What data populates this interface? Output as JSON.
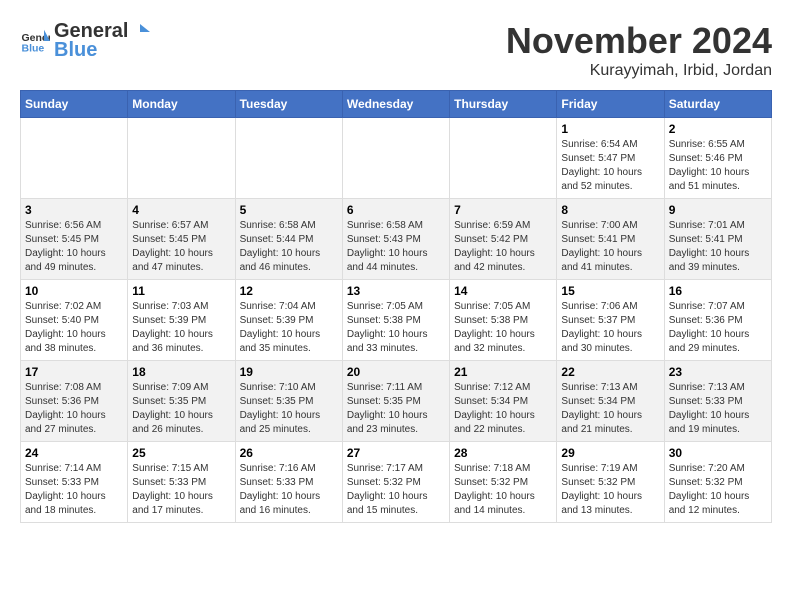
{
  "logo": {
    "text_general": "General",
    "text_blue": "Blue"
  },
  "header": {
    "month": "November 2024",
    "location": "Kurayyimah, Irbid, Jordan"
  },
  "weekdays": [
    "Sunday",
    "Monday",
    "Tuesday",
    "Wednesday",
    "Thursday",
    "Friday",
    "Saturday"
  ],
  "weeks": [
    [
      {
        "day": "",
        "info": ""
      },
      {
        "day": "",
        "info": ""
      },
      {
        "day": "",
        "info": ""
      },
      {
        "day": "",
        "info": ""
      },
      {
        "day": "",
        "info": ""
      },
      {
        "day": "1",
        "info": "Sunrise: 6:54 AM\nSunset: 5:47 PM\nDaylight: 10 hours and 52 minutes."
      },
      {
        "day": "2",
        "info": "Sunrise: 6:55 AM\nSunset: 5:46 PM\nDaylight: 10 hours and 51 minutes."
      }
    ],
    [
      {
        "day": "3",
        "info": "Sunrise: 6:56 AM\nSunset: 5:45 PM\nDaylight: 10 hours and 49 minutes."
      },
      {
        "day": "4",
        "info": "Sunrise: 6:57 AM\nSunset: 5:45 PM\nDaylight: 10 hours and 47 minutes."
      },
      {
        "day": "5",
        "info": "Sunrise: 6:58 AM\nSunset: 5:44 PM\nDaylight: 10 hours and 46 minutes."
      },
      {
        "day": "6",
        "info": "Sunrise: 6:58 AM\nSunset: 5:43 PM\nDaylight: 10 hours and 44 minutes."
      },
      {
        "day": "7",
        "info": "Sunrise: 6:59 AM\nSunset: 5:42 PM\nDaylight: 10 hours and 42 minutes."
      },
      {
        "day": "8",
        "info": "Sunrise: 7:00 AM\nSunset: 5:41 PM\nDaylight: 10 hours and 41 minutes."
      },
      {
        "day": "9",
        "info": "Sunrise: 7:01 AM\nSunset: 5:41 PM\nDaylight: 10 hours and 39 minutes."
      }
    ],
    [
      {
        "day": "10",
        "info": "Sunrise: 7:02 AM\nSunset: 5:40 PM\nDaylight: 10 hours and 38 minutes."
      },
      {
        "day": "11",
        "info": "Sunrise: 7:03 AM\nSunset: 5:39 PM\nDaylight: 10 hours and 36 minutes."
      },
      {
        "day": "12",
        "info": "Sunrise: 7:04 AM\nSunset: 5:39 PM\nDaylight: 10 hours and 35 minutes."
      },
      {
        "day": "13",
        "info": "Sunrise: 7:05 AM\nSunset: 5:38 PM\nDaylight: 10 hours and 33 minutes."
      },
      {
        "day": "14",
        "info": "Sunrise: 7:05 AM\nSunset: 5:38 PM\nDaylight: 10 hours and 32 minutes."
      },
      {
        "day": "15",
        "info": "Sunrise: 7:06 AM\nSunset: 5:37 PM\nDaylight: 10 hours and 30 minutes."
      },
      {
        "day": "16",
        "info": "Sunrise: 7:07 AM\nSunset: 5:36 PM\nDaylight: 10 hours and 29 minutes."
      }
    ],
    [
      {
        "day": "17",
        "info": "Sunrise: 7:08 AM\nSunset: 5:36 PM\nDaylight: 10 hours and 27 minutes."
      },
      {
        "day": "18",
        "info": "Sunrise: 7:09 AM\nSunset: 5:35 PM\nDaylight: 10 hours and 26 minutes."
      },
      {
        "day": "19",
        "info": "Sunrise: 7:10 AM\nSunset: 5:35 PM\nDaylight: 10 hours and 25 minutes."
      },
      {
        "day": "20",
        "info": "Sunrise: 7:11 AM\nSunset: 5:35 PM\nDaylight: 10 hours and 23 minutes."
      },
      {
        "day": "21",
        "info": "Sunrise: 7:12 AM\nSunset: 5:34 PM\nDaylight: 10 hours and 22 minutes."
      },
      {
        "day": "22",
        "info": "Sunrise: 7:13 AM\nSunset: 5:34 PM\nDaylight: 10 hours and 21 minutes."
      },
      {
        "day": "23",
        "info": "Sunrise: 7:13 AM\nSunset: 5:33 PM\nDaylight: 10 hours and 19 minutes."
      }
    ],
    [
      {
        "day": "24",
        "info": "Sunrise: 7:14 AM\nSunset: 5:33 PM\nDaylight: 10 hours and 18 minutes."
      },
      {
        "day": "25",
        "info": "Sunrise: 7:15 AM\nSunset: 5:33 PM\nDaylight: 10 hours and 17 minutes."
      },
      {
        "day": "26",
        "info": "Sunrise: 7:16 AM\nSunset: 5:33 PM\nDaylight: 10 hours and 16 minutes."
      },
      {
        "day": "27",
        "info": "Sunrise: 7:17 AM\nSunset: 5:32 PM\nDaylight: 10 hours and 15 minutes."
      },
      {
        "day": "28",
        "info": "Sunrise: 7:18 AM\nSunset: 5:32 PM\nDaylight: 10 hours and 14 minutes."
      },
      {
        "day": "29",
        "info": "Sunrise: 7:19 AM\nSunset: 5:32 PM\nDaylight: 10 hours and 13 minutes."
      },
      {
        "day": "30",
        "info": "Sunrise: 7:20 AM\nSunset: 5:32 PM\nDaylight: 10 hours and 12 minutes."
      }
    ]
  ]
}
